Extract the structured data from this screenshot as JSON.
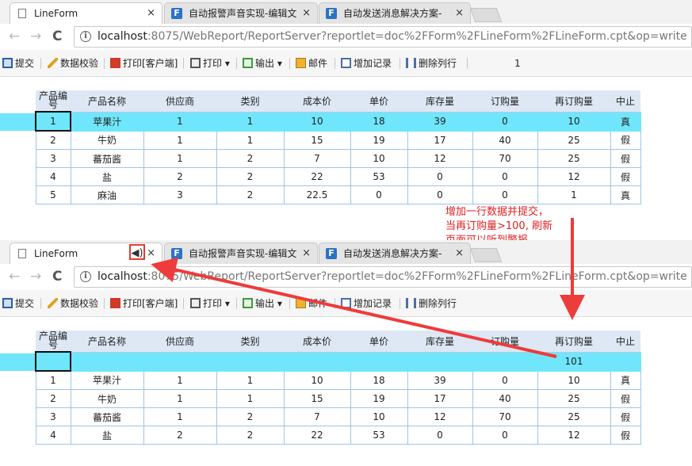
{
  "browser": {
    "tabs": [
      {
        "title": "LineForm",
        "close": "×"
      },
      {
        "title": "自动报警声音实现-编辑文",
        "close": "×"
      },
      {
        "title": "自动发送消息解决方案-",
        "close": "×"
      }
    ],
    "sound_icon": "speaker-icon",
    "nav": {
      "back": "←",
      "forward": "→",
      "reload": "C"
    },
    "url_host": "localhost",
    "url_rest": ":8075/WebReport/ReportServer?reportlet=doc%2FForm%2FLineForm%2FLineForm.cpt&op=write"
  },
  "toolbar": {
    "submit": "提交",
    "validate": "数据校验",
    "print_client": "打印[客户端]",
    "print": "打印",
    "export": "输出",
    "mail": "邮件",
    "add_record": "增加记录",
    "delete_row": "删除列行",
    "page": "1"
  },
  "table": {
    "headers": [
      "产品编号",
      "产品名称",
      "供应商",
      "类别",
      "成本价",
      "单价",
      "库存量",
      "订购量",
      "再订购量",
      "中止"
    ],
    "rows_before": [
      [
        "1",
        "苹果汁",
        "1",
        "1",
        "10",
        "18",
        "39",
        "0",
        "10",
        "真"
      ],
      [
        "2",
        "牛奶",
        "1",
        "1",
        "15",
        "19",
        "17",
        "40",
        "25",
        "假"
      ],
      [
        "3",
        "蕃茄酱",
        "1",
        "2",
        "7",
        "10",
        "12",
        "70",
        "25",
        "假"
      ],
      [
        "4",
        "盐",
        "2",
        "2",
        "22",
        "53",
        "0",
        "0",
        "12",
        "假"
      ],
      [
        "5",
        "麻油",
        "3",
        "2",
        "22.5",
        "0",
        "0",
        "0",
        "1",
        "真"
      ]
    ],
    "new_row": [
      "",
      "",
      "",
      "",
      "",
      "",
      "",
      "",
      "101",
      ""
    ],
    "rows_after": [
      [
        "1",
        "苹果汁",
        "1",
        "1",
        "10",
        "18",
        "39",
        "0",
        "10",
        "真"
      ],
      [
        "2",
        "牛奶",
        "1",
        "1",
        "15",
        "19",
        "17",
        "40",
        "25",
        "假"
      ],
      [
        "3",
        "蕃茄酱",
        "1",
        "2",
        "7",
        "10",
        "12",
        "70",
        "25",
        "假"
      ],
      [
        "4",
        "盐",
        "2",
        "2",
        "22",
        "53",
        "0",
        "0",
        "12",
        "假"
      ]
    ]
  },
  "annotation": {
    "lines": [
      "增加一行数据并提交，",
      "当再订购量>100, 刷新",
      "页面可以听到警报"
    ]
  },
  "colors": {
    "highlight_row": "#6fe6fb",
    "header_bg": "#dde8f4",
    "annotation": "#e02020"
  }
}
